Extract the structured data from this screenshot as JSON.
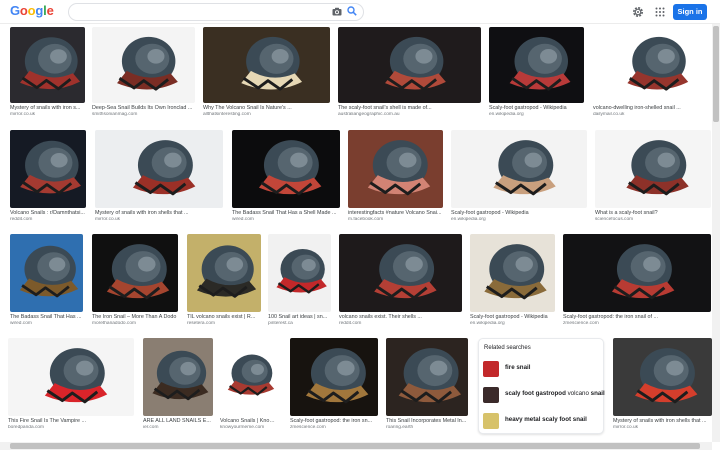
{
  "header": {
    "logo": [
      "G",
      "o",
      "o",
      "g",
      "l",
      "e"
    ],
    "search_value": "",
    "signin_label": "Sign in"
  },
  "results": [
    {
      "title": "Mystery of snails with iron s...",
      "source": "mirror.co.uk",
      "bg": "#2b2a2f",
      "accent": "#a0322c"
    },
    {
      "title": "Deep-Sea Snail Builds Its Own Ironclad ...",
      "source": "smithsonianmag.com",
      "bg": "#f4f4f4",
      "accent": "#7a2d24"
    },
    {
      "title": "Why The Volcano Snail Is Nature's ...",
      "source": "allthatsinteresting.com",
      "bg": "#3a2f22",
      "accent": "#e6d8b5"
    },
    {
      "title": "The scaly-foot snail's shell is made of...",
      "source": "australiangeographic.com.au",
      "bg": "#1f1b1c",
      "accent": "#b04a3a"
    },
    {
      "title": "Scaly-foot gastropod - Wikipedia",
      "source": "en.wikipedia.org",
      "bg": "#0f0f12",
      "accent": "#b83a39"
    },
    {
      "title": "volcano-dwelling iron-shelled snail ...",
      "source": "dailymail.co.uk",
      "bg": "#ffffff",
      "accent": "#96352d"
    },
    {
      "title": "Volcano Snails : r/Damnthatsi...",
      "source": "reddit.com",
      "bg": "#151a24",
      "accent": "#a43a31"
    },
    {
      "title": "Mystery of snails with iron shells that ...",
      "source": "mirror.co.uk",
      "bg": "#eceef0",
      "accent": "#9b3027"
    },
    {
      "title": "The Badass Snail That Has a Shell Made ...",
      "source": "wired.com",
      "bg": "#0c0c0d",
      "accent": "#c24639"
    },
    {
      "title": "interestingfacts #nature Volcano Snai...",
      "source": "m.facebook.com",
      "bg": "#7a3e2f",
      "accent": "#d28374"
    },
    {
      "title": "Scaly-foot gastropod - Wikipedia",
      "source": "en.wikipedia.org",
      "bg": "#f3f3f3",
      "accent": "#c9a07e"
    },
    {
      "title": "What is a scaly-foot snail?",
      "source": "sciencefocus.com",
      "bg": "#f5f5f5",
      "accent": "#8d3129"
    },
    {
      "title": "The Badass Snail That Has ...",
      "source": "wired.com",
      "bg": "#2f6fb0",
      "accent": "#7c5a2b"
    },
    {
      "title": "The Iron Snail – More Than A Dodo",
      "source": "morethanadodo.com",
      "bg": "#101010",
      "accent": "#a5452f"
    },
    {
      "title": "TIL volcano snails exist | R...",
      "source": "resetera.com",
      "bg": "#c3b06a",
      "accent": "#2b2a26"
    },
    {
      "title": "100 Snail art ideas | sn...",
      "source": "pinterest.ca",
      "bg": "#f1f1f1",
      "accent": "#c2282a"
    },
    {
      "title": "volcano snails exist. Their shells ...",
      "source": "reddit.com",
      "bg": "#1e1a1b",
      "accent": "#b43f35"
    },
    {
      "title": "Scaly-foot gastropod - Wikipedia",
      "source": "en.wikipedia.org",
      "bg": "#e7e2d8",
      "accent": "#8a6b3a"
    },
    {
      "title": "Scaly-foot gastropod: the iron snail of ...",
      "source": "zmescience.com",
      "bg": "#121214",
      "accent": "#b83b33"
    },
    {
      "title": "This Fire Snail Is The Vampire ...",
      "source": "boredpanda.com",
      "bg": "#f5f5f5",
      "accent": "#d9242a"
    },
    {
      "title": "ARE ALL LAND SNAILS E...",
      "source": "ier.com",
      "bg": "#8a7e72",
      "accent": "#3b2b21"
    },
    {
      "title": "Volcano Snails | Know ...",
      "source": "knowyourmeme.com",
      "bg": "#ffffff",
      "accent": "#a83a31"
    },
    {
      "title": "Scaly-foot gastropod: the iron sn...",
      "source": "zmescience.com",
      "bg": "#17130f",
      "accent": "#a1773c"
    },
    {
      "title": "This Snail Incorporates Metal In...",
      "source": "roaring.earth",
      "bg": "#2c2420",
      "accent": "#8e5a3c"
    },
    {
      "title": "Mystery of snails with iron shells that ...",
      "source": "mirror.co.uk",
      "bg": "#3a3a3a",
      "accent": "#d43e2c"
    }
  ],
  "related": {
    "title": "Related searches",
    "items": [
      {
        "parts": [
          [
            "fire snail",
            true
          ]
        ],
        "thumb": "#c2282a"
      },
      {
        "parts": [
          [
            "scaly foot gastropod",
            true
          ],
          [
            " volcano ",
            false
          ],
          [
            "snail",
            true
          ]
        ],
        "thumb": "#3b2a2a"
      },
      {
        "parts": [
          [
            "heavy metal scaly foot snail",
            true
          ]
        ],
        "thumb": "#d7c26a"
      }
    ]
  },
  "colors": {
    "accent": "#1a73e8",
    "source": "#70757a"
  }
}
